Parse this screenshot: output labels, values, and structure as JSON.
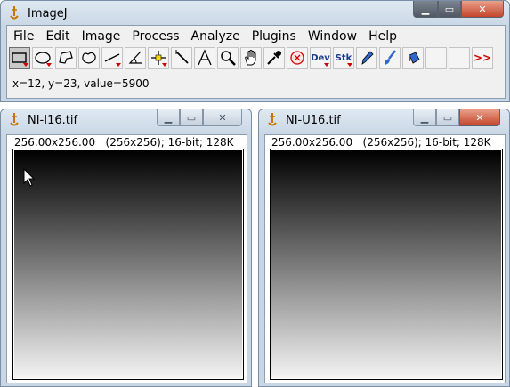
{
  "main_window": {
    "title": "ImageJ",
    "menu": [
      "File",
      "Edit",
      "Image",
      "Process",
      "Analyze",
      "Plugins",
      "Window",
      "Help"
    ],
    "tools": [
      {
        "name": "rectangle-tool",
        "selected": true,
        "dropdown": true
      },
      {
        "name": "oval-tool",
        "dropdown": true
      },
      {
        "name": "polygon-tool"
      },
      {
        "name": "freehand-tool"
      },
      {
        "name": "line-tool",
        "dropdown": true
      },
      {
        "name": "angle-tool"
      },
      {
        "name": "point-tool",
        "dropdown": true
      },
      {
        "name": "wand-tool"
      },
      {
        "name": "text-tool"
      },
      {
        "name": "magnifier-tool"
      },
      {
        "name": "hand-tool"
      },
      {
        "name": "color-picker-tool"
      },
      {
        "name": "stop-tool"
      },
      {
        "name": "dev-menu",
        "label": "Dev",
        "dropdown": true
      },
      {
        "name": "stk-menu",
        "label": "Stk",
        "dropdown": true
      },
      {
        "name": "pencil-tool"
      },
      {
        "name": "brush-tool"
      },
      {
        "name": "flood-fill-tool"
      },
      {
        "name": "empty-slot-1"
      },
      {
        "name": "empty-slot-2"
      },
      {
        "name": "more-tools",
        "label": ">>"
      }
    ],
    "status": "x=12, y=23, value=5900",
    "controls": {
      "minimize": "▁",
      "maximize": "▭",
      "close": "✕"
    }
  },
  "image_windows": [
    {
      "title": "NI-I16.tif",
      "info": "256.00x256.00   (256x256); 16-bit; 128K"
    },
    {
      "title": "NI-U16.tif",
      "info": "256.00x256.00   (256x256); 16-bit; 128K"
    }
  ],
  "colors": {
    "accent_red": "#d00000",
    "frame": "#c8d6e5"
  }
}
